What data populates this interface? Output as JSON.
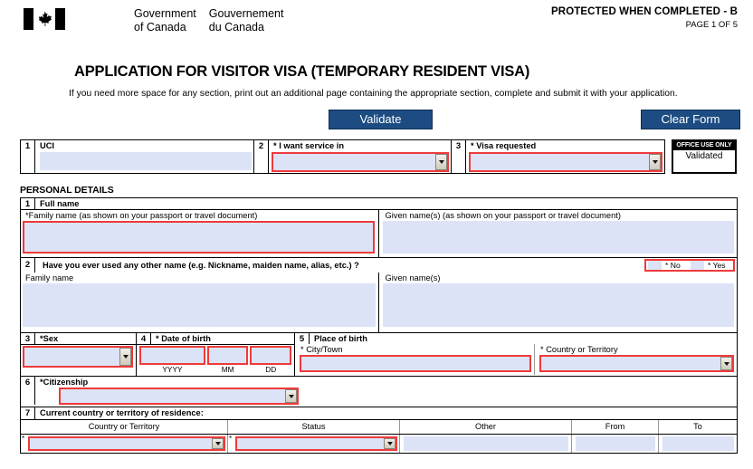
{
  "header": {
    "goc_en_line1": "Government",
    "goc_en_line2": "of Canada",
    "goc_fr_line1": "Gouvernement",
    "goc_fr_line2": "du Canada",
    "flag_icon": "canada-flag-icon",
    "protected_notice": "PROTECTED WHEN COMPLETED - B",
    "page_indicator": "PAGE 1 OF 5"
  },
  "title": {
    "main": "APPLICATION FOR VISITOR VISA (TEMPORARY RESIDENT VISA)",
    "subtitle": "If you need more space for any section, print out an additional page containing the appropriate section, complete and submit it with your application."
  },
  "toolbar": {
    "validate_label": "Validate",
    "clear_label": "Clear Form",
    "button_color": "#1c4c82"
  },
  "colors": {
    "field_fill": "#dde3f7",
    "required_outline": "#ee3a3a",
    "accent": "#1c4c82"
  },
  "row1": {
    "uci": {
      "num": "1",
      "label": "UCI",
      "value": ""
    },
    "service_in": {
      "num": "2",
      "label": "* I want service in",
      "value": "",
      "dropdown_icon": "chevron-down-icon"
    },
    "visa_requested": {
      "num": "3",
      "label": "* Visa requested",
      "value": "",
      "dropdown_icon": "chevron-down-icon"
    },
    "office_use": {
      "header": "OFFICE USE ONLY",
      "value": "Validated"
    }
  },
  "personal_details": {
    "section_title": "PERSONAL DETAILS",
    "q1": {
      "num": "1",
      "label": "Full name",
      "family_name_label": "*Family name  (as shown on your passport or travel document)",
      "family_name_value": "",
      "given_name_label": "Given name(s)  (as shown on your passport or travel document)",
      "given_name_value": ""
    },
    "q2": {
      "num": "2",
      "label": "Have you ever used any other name (e.g. Nickname, maiden name, alias, etc.) ?",
      "option_no": "* No",
      "option_yes": "* Yes",
      "no_checked": false,
      "yes_checked": false,
      "family_name_label": "Family name",
      "family_name_value": "",
      "given_name_label": "Given name(s)",
      "given_name_value": ""
    },
    "q3": {
      "num": "3",
      "label": "*Sex",
      "value": "",
      "dropdown_icon": "chevron-down-icon"
    },
    "q4": {
      "num": "4",
      "label": "* Date of birth",
      "yyyy_label": "YYYY",
      "yyyy_value": "",
      "mm_label": "MM",
      "mm_value": "",
      "dd_label": "DD",
      "dd_value": ""
    },
    "q5": {
      "num": "5",
      "label": "Place of birth",
      "city_label": "* City/Town",
      "city_value": "",
      "country_label": "* Country or Territory",
      "country_value": "",
      "dropdown_icon": "chevron-down-icon"
    },
    "q6": {
      "num": "6",
      "label": "*Citizenship",
      "value": "",
      "dropdown_icon": "chevron-down-icon"
    },
    "q7": {
      "num": "7",
      "label": "Current country or territory of residence:",
      "columns": [
        "Country or Territory",
        "Status",
        "Other",
        "From",
        "To"
      ],
      "rows": [
        {
          "country": "",
          "status": "",
          "other": "",
          "from": "",
          "to": "",
          "required_marker": "*"
        }
      ]
    }
  }
}
